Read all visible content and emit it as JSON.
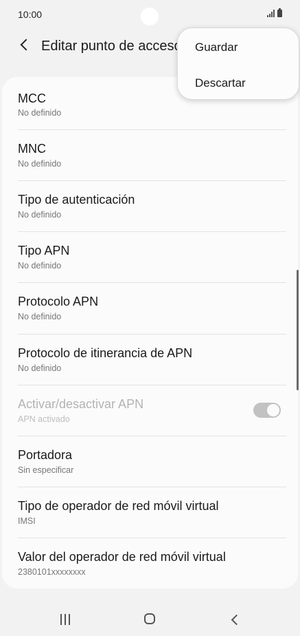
{
  "status_bar": {
    "time": "10:00"
  },
  "app_bar": {
    "title": "Editar punto de acceso"
  },
  "menu": {
    "items": [
      {
        "label": "Guardar"
      },
      {
        "label": "Descartar"
      }
    ]
  },
  "settings": {
    "items": [
      {
        "title": "MCC",
        "value": "No definido"
      },
      {
        "title": "MNC",
        "value": "No definido"
      },
      {
        "title": "Tipo de autenticación",
        "value": "No definido"
      },
      {
        "title": "Tipo APN",
        "value": "No definido"
      },
      {
        "title": "Protocolo APN",
        "value": "No definido"
      },
      {
        "title": "Protocolo de itinerancia de APN",
        "value": "No definido"
      },
      {
        "title": "Activar/desactivar APN",
        "value": "APN activado",
        "toggle_on": true,
        "disabled": true
      },
      {
        "title": "Portadora",
        "value": "Sin especificar"
      },
      {
        "title": "Tipo de operador de red móvil virtual",
        "value": "IMSI"
      },
      {
        "title": "Valor del operador de red móvil virtual",
        "value": "2380101xxxxxxxx"
      }
    ]
  },
  "icons": {
    "back": "back-arrow-icon",
    "signal": "signal-icon",
    "battery": "battery-icon",
    "recent_apps": "recent-apps-icon",
    "home": "home-icon",
    "nav_back": "nav-back-icon"
  },
  "colors": {
    "background": "#f2f2f2",
    "card": "#fbfbfb",
    "toggle": "#c2c2c2"
  }
}
